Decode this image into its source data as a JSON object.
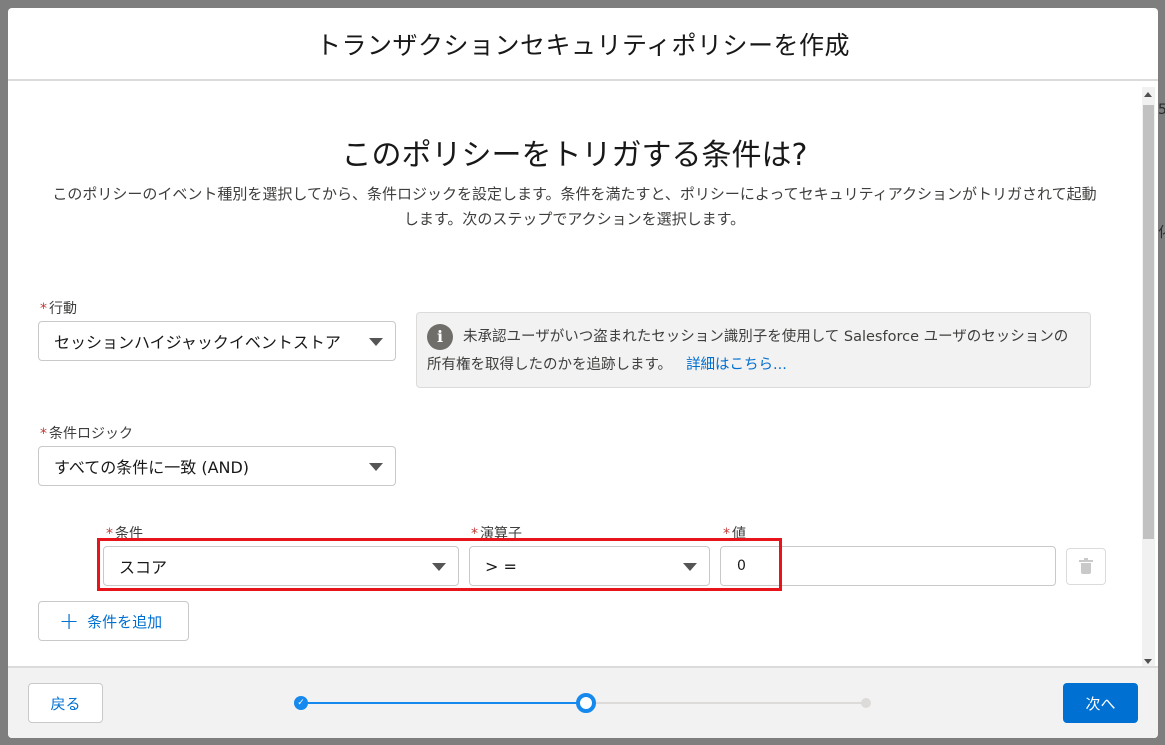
{
  "modal": {
    "title": "トランザクションセキュリティポリシーを作成"
  },
  "step": {
    "heading": "このポリシーをトリガする条件は?",
    "description": "このポリシーのイベント種別を選択してから、条件ロジックを設定します。条件を満たすと、ポリシーによってセキュリティアクションがトリガされて起動します。次のステップでアクションを選択します。"
  },
  "event": {
    "label": "行動",
    "required_mark": "*",
    "value": "セッションハイジャックイベントストア"
  },
  "info": {
    "icon": "info-icon",
    "text": "未承認ユーザがいつ盗まれたセッション識別子を使用して Salesforce ユーザのセッションの所有権を取得したのかを追跡します。",
    "link": "詳細はこちら..."
  },
  "logic": {
    "label": "条件ロジック",
    "required_mark": "*",
    "value": "すべての条件に一致 (AND)"
  },
  "condition": {
    "field_label": "条件",
    "field_value": "スコア",
    "operator_label": "演算子",
    "operator_value": "> =",
    "value_label": "値",
    "value": "0",
    "required_mark": "*"
  },
  "add_condition": {
    "label": "条件を追加",
    "icon": "plus-icon"
  },
  "footer": {
    "back": "戻る",
    "next": "次へ",
    "progress": {
      "total_steps": 3,
      "current_step": 2
    }
  },
  "background": {
    "right_text_1": "5",
    "right_text_2": "化"
  },
  "colors": {
    "brand": "#0070d2",
    "progress": "#1589ee",
    "required": "#c23934",
    "highlight": "#e8141b"
  }
}
